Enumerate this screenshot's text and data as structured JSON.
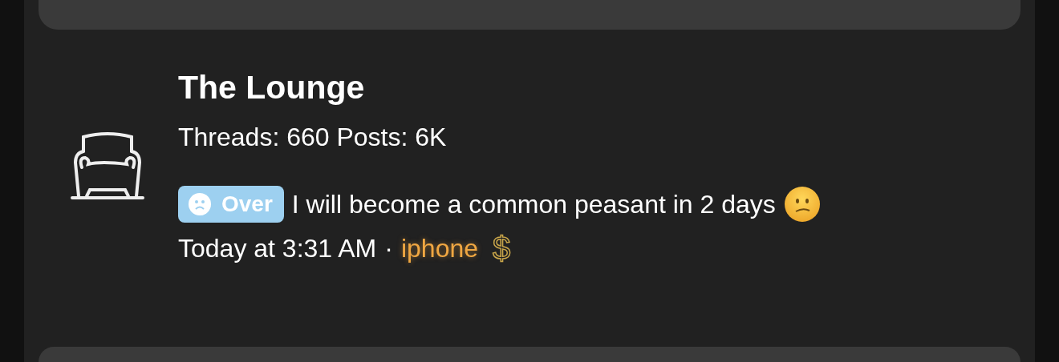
{
  "forum": {
    "title": "The Lounge",
    "stats": "Threads: 660 Posts: 6K",
    "latest": {
      "prefix": "Over",
      "title": "I will become a common peasant in 2 days",
      "time": "Today at 3:31 AM",
      "separator": "·",
      "user": "iphone",
      "user_badge": "$"
    }
  }
}
